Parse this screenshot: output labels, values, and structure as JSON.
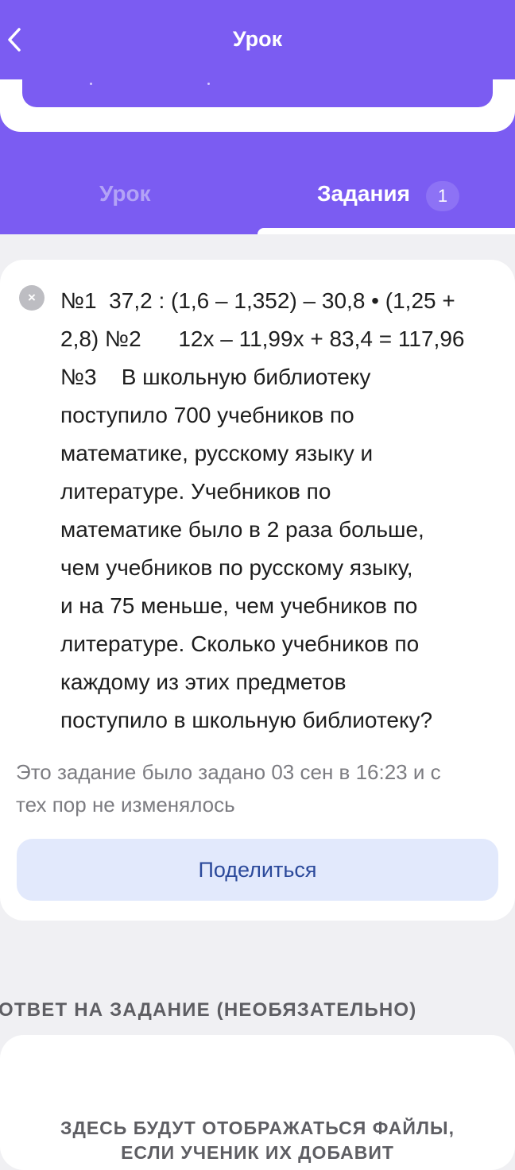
{
  "header": {
    "title": "Урок",
    "back_icon": "chevron-left-icon",
    "background_color": "#7b5cf2"
  },
  "tabs": [
    {
      "label": "Урок",
      "active": false
    },
    {
      "label": "Задания",
      "active": true,
      "badge": "1"
    }
  ],
  "task": {
    "close_icon": "close-icon",
    "lines": [
      "№1  37,2 : (1,6 – 1,352) – 30,8 • (1,25 +",
      "2,8) №2      12x – 11,99x + 83,4 = 117,96",
      "№3    В школьную библиотеку",
      "поступило 700 учебников по",
      "математике, русскому языку и",
      "литературе. Учебников по",
      "математике было в 2 раза больше,",
      "чем учебников по русскому языку,",
      "и на 75 меньше, чем учебников по",
      "литературе. Сколько учебников по",
      "каждому из этих предметов",
      "поступило в школьную библиотеку?"
    ],
    "note_line1": "Это задание было задано 03 сен в 16:23 и с",
    "note_line2": "тех пор не изменялось",
    "share_label": "Поделиться"
  },
  "answer": {
    "section_label": "ОТВЕТ НА ЗАДАНИЕ (НЕОБЯЗАТЕЛЬНО)",
    "files_line1": "ЗДЕСЬ БУДУТ ОТОБРАЖАТЬСЯ ФАЙЛЫ,",
    "files_line2": "ЕСЛИ УЧЕНИК ИХ ДОБАВИТ"
  }
}
